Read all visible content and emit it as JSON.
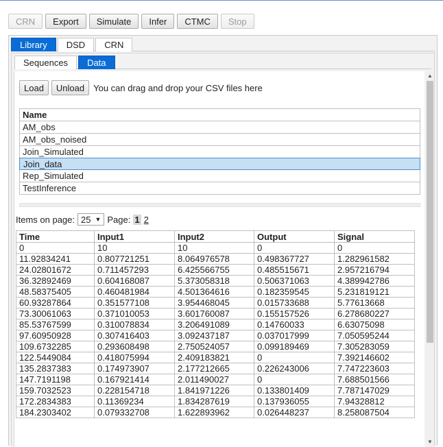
{
  "toolbar": {
    "buttons": [
      {
        "label": "CRN",
        "disabled": true
      },
      {
        "label": "Export",
        "disabled": false
      },
      {
        "label": "Simulate",
        "disabled": false
      },
      {
        "label": "Infer",
        "disabled": false
      },
      {
        "label": "CTMC",
        "disabled": false
      },
      {
        "label": "Stop",
        "disabled": true
      }
    ]
  },
  "main_tabs": [
    {
      "label": "Library",
      "active": true
    },
    {
      "label": "DSD",
      "active": false
    },
    {
      "label": "CRN",
      "active": false
    }
  ],
  "sub_tabs": [
    {
      "label": "Sequences",
      "active": false
    },
    {
      "label": "Data",
      "active": true
    }
  ],
  "loader": {
    "load_label": "Load",
    "unload_label": "Unload",
    "hint": "You can drag and drop your CSV files here"
  },
  "datasets": {
    "header": "Name",
    "rows": [
      "AM_obs",
      "AM_obs_noised",
      "Join_Simulated",
      "Join_data",
      "Rep_Simulated",
      "TestInference"
    ],
    "selected": "Join_data"
  },
  "pager": {
    "items_label": "Items on page:",
    "items_value": "25",
    "page_label": "Page:",
    "pages": [
      "1",
      "2"
    ],
    "current_page": "1"
  },
  "table": {
    "columns": [
      "Time",
      "Input1",
      "Input2",
      "Output",
      "Signal"
    ],
    "rows": [
      [
        "0",
        "10",
        "10",
        "0",
        "0"
      ],
      [
        "11.92834241",
        "0.807721251",
        "8.064976578",
        "0.498367727",
        "1.282961582"
      ],
      [
        "24.02801672",
        "0.711457293",
        "6.425566755",
        "0.485515671",
        "2.957216794"
      ],
      [
        "36.32892469",
        "0.604168087",
        "5.373058318",
        "0.506371063",
        "4.389942786"
      ],
      [
        "48.58375405",
        "0.460481984",
        "4.501364616",
        "0.182359545",
        "5.231819121"
      ],
      [
        "60.93287864",
        "0.351577108",
        "3.954468045",
        "0.015733688",
        "5.77613668"
      ],
      [
        "73.30061063",
        "0.371010053",
        "3.601760087",
        "0.155157526",
        "6.278680227"
      ],
      [
        "85.53767599",
        "0.310078834",
        "3.206491089",
        "0.14760033",
        "6.63075098"
      ],
      [
        "97.60950928",
        "0.307416403",
        "3.092437187",
        "0.037017999",
        "7.050595244"
      ],
      [
        "109.6732285",
        "0.293608498",
        "2.750524057",
        "0.099189469",
        "7.305283059"
      ],
      [
        "122.5449084",
        "0.418075994",
        "2.409183821",
        "0",
        "7.392146602"
      ],
      [
        "135.2837383",
        "0.174973907",
        "2.177212665",
        "0.226243006",
        "7.747223603"
      ],
      [
        "147.7191198",
        "0.167921414",
        "2.011490027",
        "0",
        "7.688501566"
      ],
      [
        "159.7032523",
        "0.228154718",
        "1.841971226",
        "0.133801409",
        "7.787147029"
      ],
      [
        "172.2834383",
        "0.11369234",
        "1.834287619",
        "0.137936055",
        "7.94328812"
      ],
      [
        "184.2303402",
        "0.079332708",
        "1.622893962",
        "0.026448237",
        "8.258087504"
      ]
    ]
  }
}
